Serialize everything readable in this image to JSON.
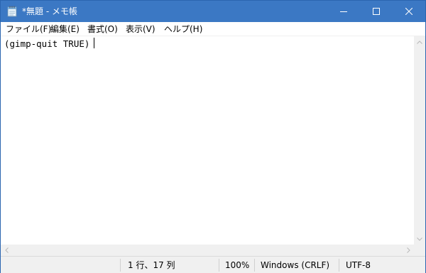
{
  "window": {
    "title": "*無題 - メモ帳",
    "titlebar_color": "#3b78c4"
  },
  "icons": {
    "app": "notepad-icon",
    "minimize": "minimize-icon",
    "maximize": "maximize-icon",
    "close": "close-icon"
  },
  "menu": {
    "items": [
      {
        "label": "ファイル(F)"
      },
      {
        "label": "編集(E)"
      },
      {
        "label": "書式(O)"
      },
      {
        "label": "表示(V)"
      },
      {
        "label": "ヘルプ(H)"
      }
    ]
  },
  "editor": {
    "content": "(gimp-quit TRUE)"
  },
  "statusbar": {
    "position": "1 行、17 列",
    "zoom": "100%",
    "line_ending": "Windows (CRLF)",
    "encoding": "UTF-8"
  }
}
